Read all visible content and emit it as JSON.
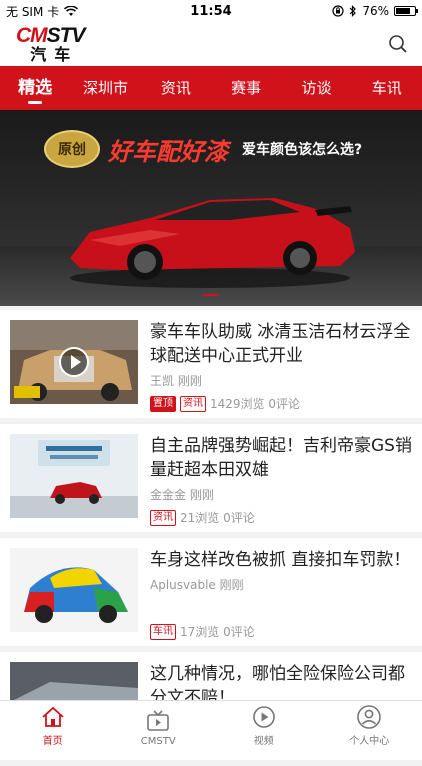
{
  "status_bar": {
    "carrier": "无 SIM 卡",
    "time": "11:54",
    "battery": "76%",
    "battery_level": 0.76
  },
  "header": {
    "logo_top_red": "CM",
    "logo_top_black": "STV",
    "logo_bottom": "汽车",
    "search_icon": "search-icon"
  },
  "tabs": [
    "精选",
    "深圳市",
    "资讯",
    "赛事",
    "访谈",
    "车讯"
  ],
  "active_tab": 0,
  "banner": {
    "badge": "原创",
    "title": "好车配好漆",
    "subtitle": "爱车颜色该怎么选?"
  },
  "news": [
    {
      "title": "豪车车队助威 冰清玉洁石材云浮全球配送中心正式开业",
      "author": "王凯 刚刚",
      "top_tag": "置顶",
      "tag": "资讯",
      "stats": "1429浏览 0评论"
    },
    {
      "title": "自主品牌强势崛起！吉利帝豪GS销量赶超本田双雄",
      "author": "金金金 刚刚",
      "tag": "资讯",
      "stats": "21浏览 0评论"
    },
    {
      "title": "车身这样改色被抓 直接扣车罚款！",
      "author": "Aplusvable 刚刚",
      "tag": "车讯",
      "stats": "17浏览 0评论"
    },
    {
      "title": "这几种情况，哪怕全险保险公司都分文不赔！"
    }
  ],
  "tab_bar": [
    {
      "label": "首页",
      "icon": "home-icon"
    },
    {
      "label": "CMSTV",
      "icon": "tv-icon"
    },
    {
      "label": "视频",
      "icon": "play-circle-icon"
    },
    {
      "label": "个人中心",
      "icon": "user-icon"
    }
  ],
  "colors": {
    "brand_red": "#d0121b"
  }
}
